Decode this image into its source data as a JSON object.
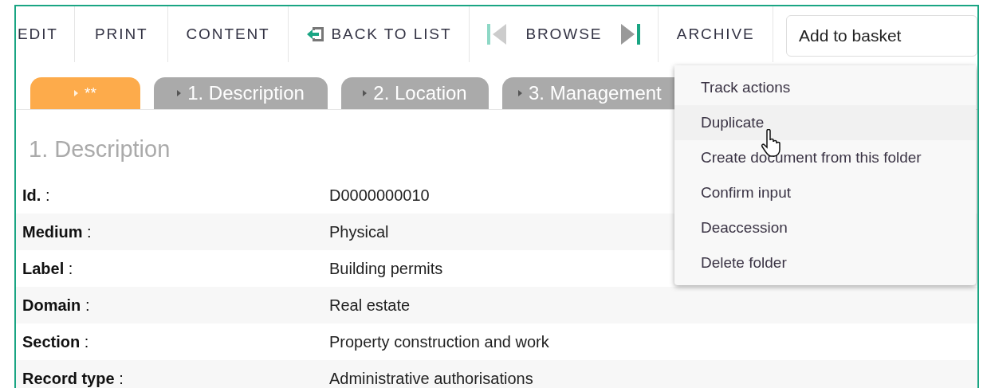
{
  "toolbar": [
    {
      "kind": "text",
      "label": "EDIT"
    },
    {
      "kind": "text",
      "label": "PRINT"
    },
    {
      "kind": "text",
      "label": "CONTENT"
    },
    {
      "kind": "back",
      "label": "BACK TO LIST"
    },
    {
      "kind": "browse",
      "label": "BROWSE"
    },
    {
      "kind": "text",
      "label": "ARCHIVE"
    }
  ],
  "basket_field": {
    "value": "Add to basket"
  },
  "tabs": [
    {
      "label": "**",
      "selected": true
    },
    {
      "label": "1. Description",
      "selected": false
    },
    {
      "label": "2. Location",
      "selected": false
    },
    {
      "label": "3. Management",
      "selected": false
    }
  ],
  "section_title": "1. Description",
  "fields": [
    {
      "label": "**Id.** :",
      "value": "D0000000010"
    },
    {
      "label": "**Medium** :",
      "value": "Physical"
    },
    {
      "label": "**Label** :",
      "value": "Building permits"
    },
    {
      "label": "**Domain** :",
      "value": "Real estate"
    },
    {
      "label": "**Section** :",
      "value": "Property construction and work"
    },
    {
      "label": "**Record type** :",
      "value": "Administrative authorisations"
    }
  ],
  "archive_menu": [
    {
      "label": "Track actions",
      "hovered": false
    },
    {
      "label": "Duplicate",
      "hovered": true
    },
    {
      "label": "Create document from this folder",
      "hovered": false
    },
    {
      "label": "Confirm input",
      "hovered": false
    },
    {
      "label": "Deaccession",
      "hovered": false
    },
    {
      "label": "Delete folder",
      "hovered": false
    }
  ]
}
